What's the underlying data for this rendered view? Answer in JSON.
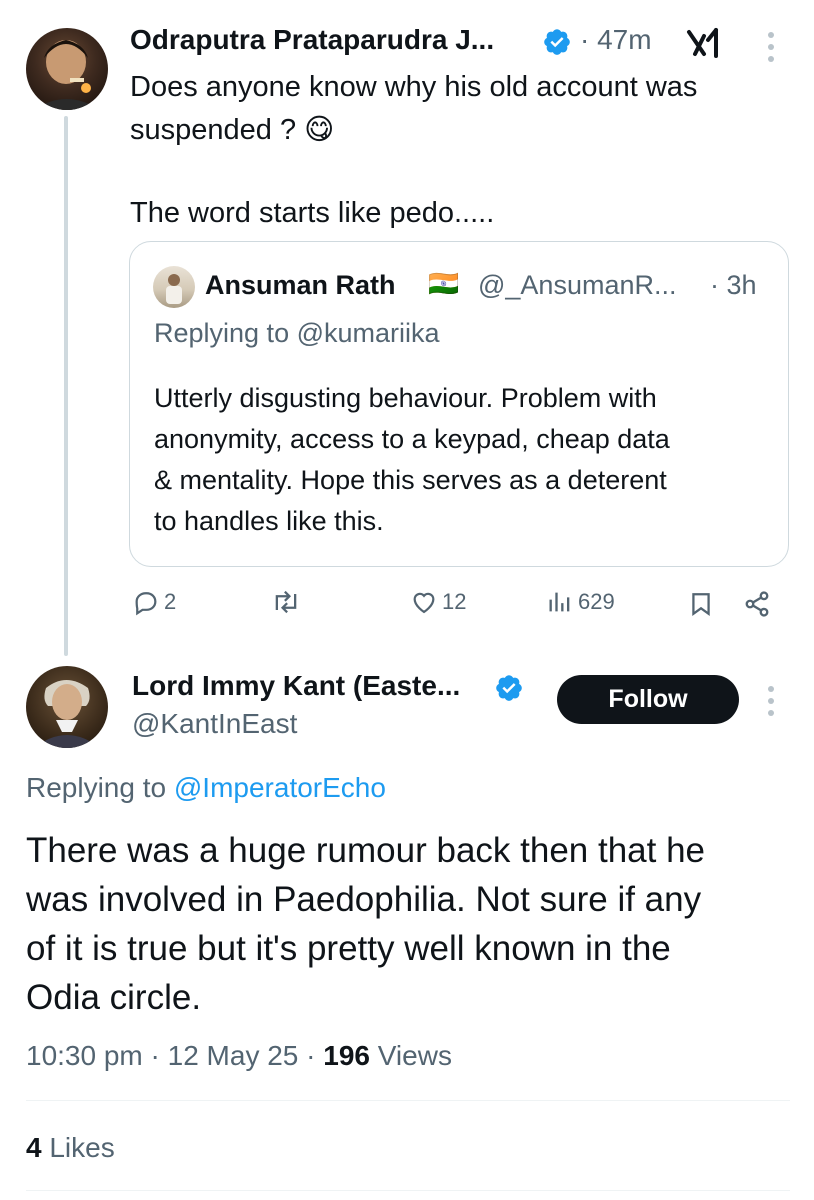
{
  "post1": {
    "author_name": "Odraputra Prataparudra J...",
    "time": "· 47m",
    "body_line1": "Does anyone  know why his old account was",
    "body_line2": "suspended ? 😋",
    "body_line3": "The word starts like pedo.....",
    "quote": {
      "name": "Ansuman Rath",
      "flag": "🇮🇳",
      "handle": "@_AnsumanR...",
      "time": "· 3h",
      "replying_prefix": "Replying to ",
      "replying_handle": "@kumariika",
      "lines": [
        "Utterly disgusting behaviour. Problem with",
        "anonymity, access to a keypad, cheap data",
        "& mentality. Hope this serves as a deterent",
        "to handles like this."
      ]
    },
    "actions": {
      "replies": "2",
      "likes": "12",
      "views": "629"
    }
  },
  "post2": {
    "author_name": "Lord Immy Kant (Easte...",
    "handle": "@KantInEast",
    "follow_label": "Follow",
    "replying_prefix": "Replying to ",
    "replying_handle": "@ImperatorEcho",
    "lines": [
      "There was a huge rumour back then that he",
      "was involved in Paedophilia. Not sure if any",
      "of it is true but it's pretty well known in the",
      "Odia circle."
    ],
    "timestamp": "10:30 pm · 12 May 25 · ",
    "views_count": "196",
    "views_label": " Views",
    "likes_count": "4",
    "likes_label": " Likes"
  },
  "colors": {
    "text": "#0f1419",
    "muted": "#536471",
    "link": "#1d9bf0",
    "verified": "#1d9bf0",
    "follow_bg": "#0f1419"
  }
}
